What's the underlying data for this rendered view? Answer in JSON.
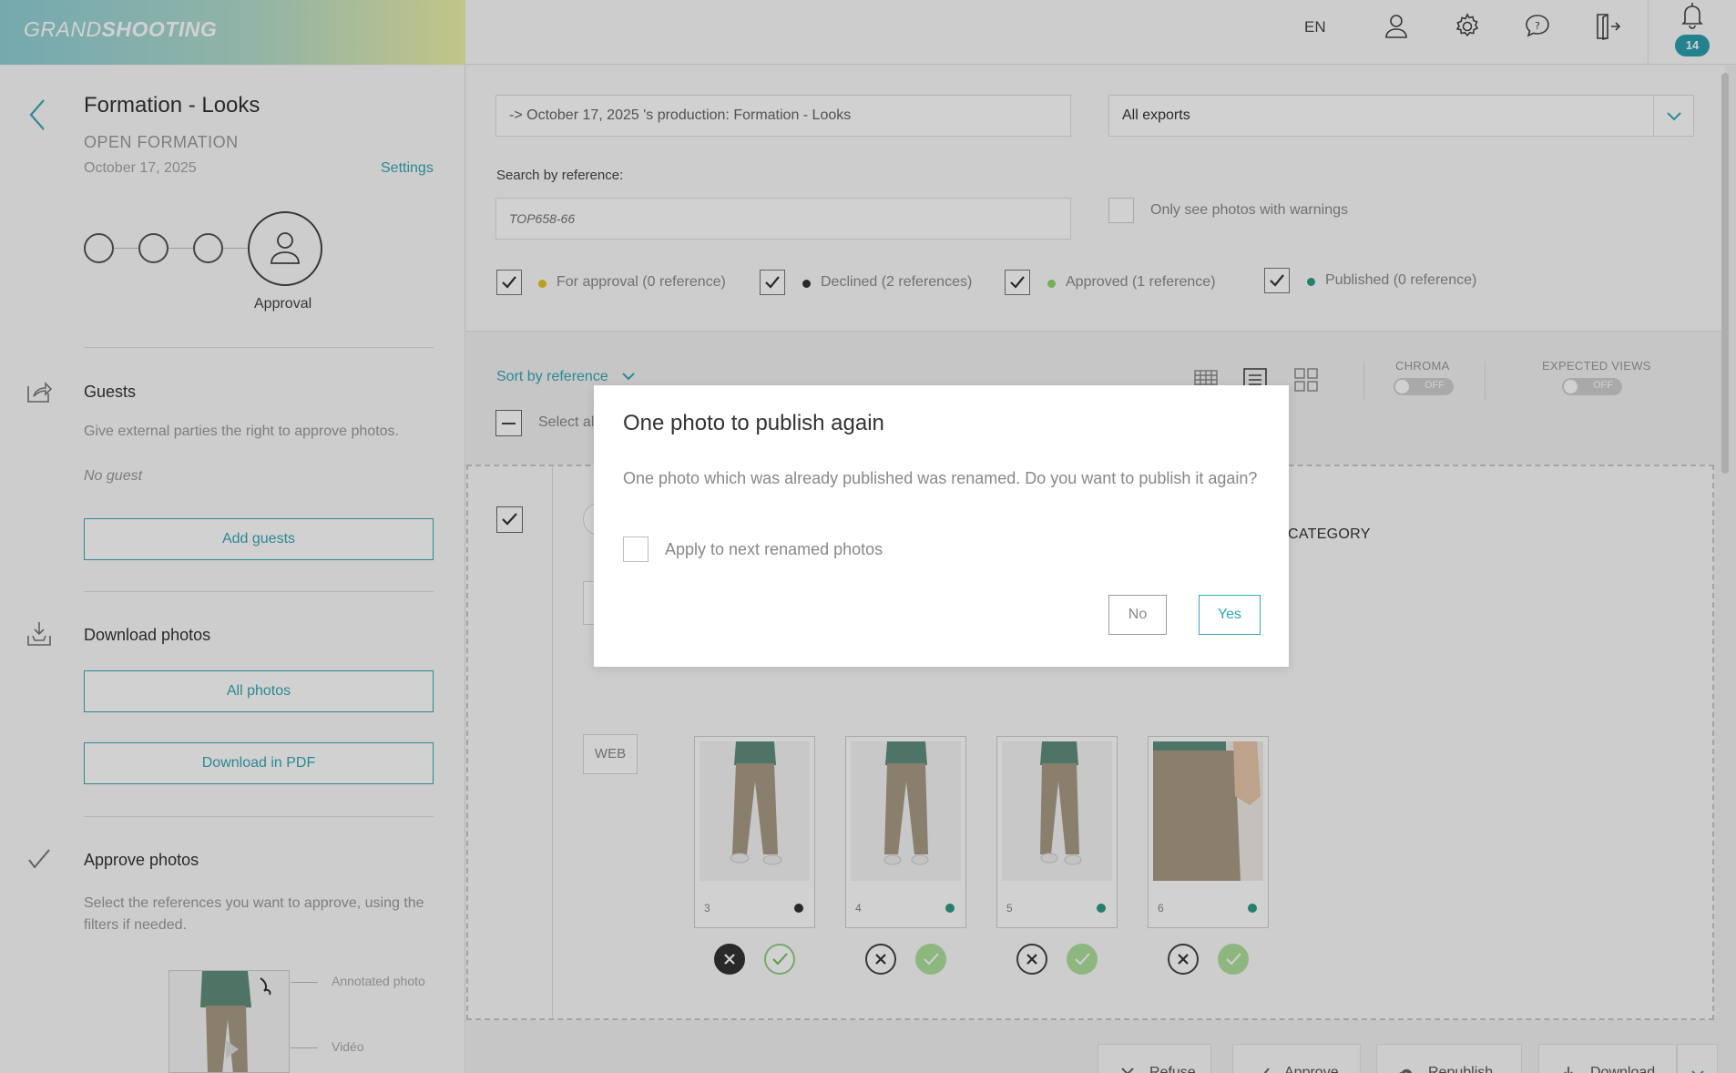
{
  "brand": {
    "part1": "GRAND",
    "part2": "SHOOTING"
  },
  "topbar": {
    "lang": "EN",
    "notif_count": "14"
  },
  "sidebar": {
    "title": "Formation - Looks",
    "subtitle": "OPEN FORMATION",
    "date": "October 17, 2025",
    "settings_link": "Settings",
    "step_label": "Approval",
    "guests": {
      "title": "Guests",
      "desc": "Give external parties the right to approve photos.",
      "empty": "No guest",
      "button": "Add guests"
    },
    "download": {
      "title": "Download photos",
      "btn_all": "All photos",
      "btn_pdf": "Download in PDF"
    },
    "approve": {
      "title": "Approve photos",
      "desc": "Select the references you want to approve, using the filters if needed."
    },
    "legend": {
      "annotated": "Annotated photo",
      "video": "Vidéo"
    }
  },
  "filters": {
    "production_value": "-> October 17, 2025 's production: Formation - Looks",
    "export_select": "All exports",
    "search_label": "Search by reference:",
    "search_placeholder": "TOP658-66",
    "warnings_label": "Only see photos with warnings",
    "statuses": [
      {
        "label": "For approval (0 reference)",
        "color": "#e6c229"
      },
      {
        "label": "Declined (2 references)",
        "color": "#333333"
      },
      {
        "label": "Approved (1 reference)",
        "color": "#8ed46a"
      },
      {
        "label": "Published (0 reference)",
        "color": "#2e9b86"
      }
    ]
  },
  "toolbar": {
    "sort": "Sort by reference",
    "chroma_label": "CHROMA",
    "chroma_state": "OFF",
    "views_label": "EXPECTED VIEWS",
    "views_state": "OFF",
    "select_all": "Select all"
  },
  "reference": {
    "category": "CATEGORY",
    "web_tag": "WEB",
    "photos": [
      {
        "num": "3",
        "status_color": "#333333",
        "declined": true
      },
      {
        "num": "4",
        "status_color": "#2e9b86",
        "declined": false
      },
      {
        "num": "5",
        "status_color": "#2e9b86",
        "declined": false
      },
      {
        "num": "6",
        "status_color": "#2e9b86",
        "declined": false
      }
    ]
  },
  "actions": {
    "refuse": "Refuse",
    "approve": "Approve",
    "republish": "Republish",
    "download": "Download"
  },
  "modal": {
    "title": "One photo to publish again",
    "message": "One photo which was already published was renamed. Do you want to publish it again?",
    "checkbox_label": "Apply to next renamed photos",
    "no": "No",
    "yes": "Yes"
  }
}
